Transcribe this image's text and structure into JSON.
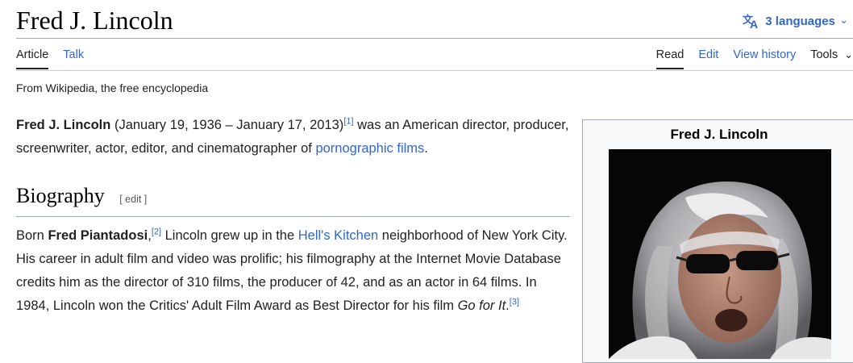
{
  "page": {
    "title": "Fred J. Lincoln",
    "languages": "3 languages",
    "tagline": "From Wikipedia, the free encyclopedia"
  },
  "tabs": {
    "left": [
      "Article",
      "Talk"
    ],
    "right": [
      "Read",
      "Edit",
      "View history",
      "Tools"
    ]
  },
  "intro": {
    "subject": "Fred J. Lincoln",
    "dates": " (January 19, 1936 – January 17, 2013)",
    "ref1": "[1]",
    "text1": " was an American director, producer, screenwriter, actor, editor, and cinematographer of ",
    "link": "pornographic films",
    "end": "."
  },
  "section": {
    "title": "Biography",
    "edit": "[ edit ]"
  },
  "bio": {
    "born": "Born ",
    "birthname": "Fred Piantadosi",
    "comma": ",",
    "ref2": "[2]",
    "text1": " Lincoln grew up in the ",
    "link": "Hell's Kitchen",
    "text2": " neighborhood of New York City. His career in adult film and video was prolific; his filmography at the Internet Movie Database credits him as the director of 310 films, the producer of 42, and as an actor in 64 films. In 1984, Lincoln won the Critics' Adult Film Award as Best Director for his film ",
    "film": "Go for It",
    "end": ".",
    "ref3": "[3]"
  },
  "infobox": {
    "title": "Fred J. Lincoln"
  },
  "icons": [
    "translate-icon",
    "chevron-down-icon"
  ]
}
